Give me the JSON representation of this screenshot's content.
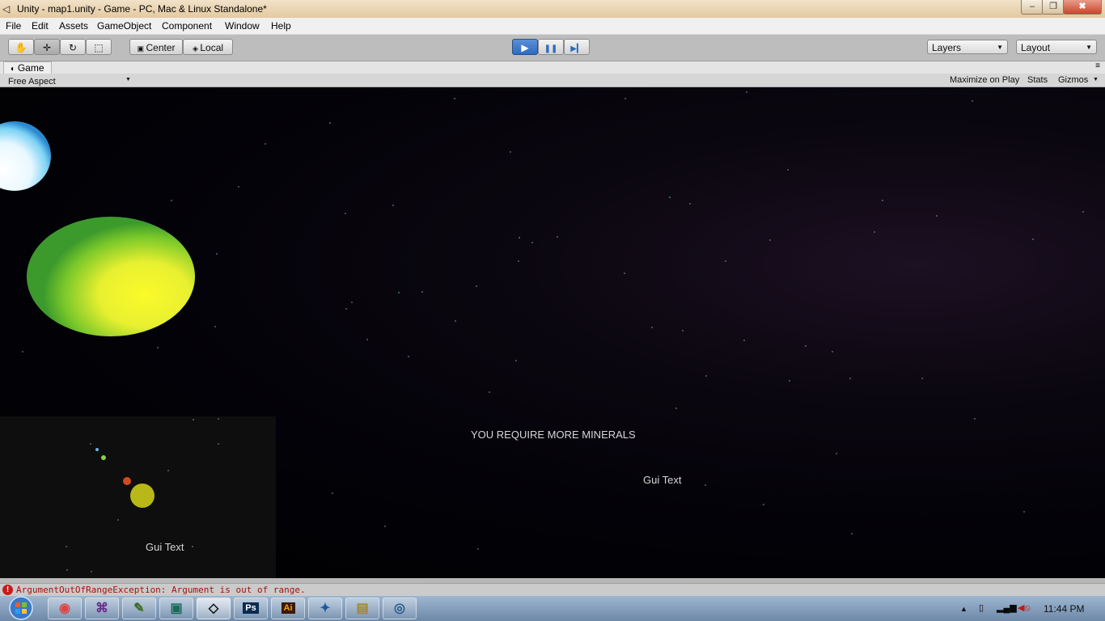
{
  "window": {
    "title": "Unity - map1.unity - Game - PC, Mac & Linux Standalone*",
    "minimize_glyph": "–",
    "maximize_glyph": "❐",
    "close_glyph": "✖"
  },
  "menu": [
    "File",
    "Edit",
    "Assets",
    "GameObject",
    "Component",
    "Window",
    "Help"
  ],
  "toolbar": {
    "tools": [
      {
        "name": "hand-tool",
        "glyph": "✋"
      },
      {
        "name": "move-tool",
        "glyph": "✛"
      },
      {
        "name": "rotate-tool",
        "glyph": "↻"
      },
      {
        "name": "scale-tool",
        "glyph": "⬚"
      }
    ],
    "pivot_label": "Center",
    "space_label": "Local",
    "play_glyph": "▶",
    "pause_glyph": "❚❚",
    "step_glyph": "▶▎",
    "layers_label": "Layers",
    "layout_label": "Layout"
  },
  "game_tab": {
    "label": "Game",
    "aspect": "Free Aspect",
    "maximize_on_play": "Maximize on Play",
    "stats": "Stats",
    "gizmos": "Gizmos"
  },
  "game_view": {
    "message": "YOU REQUIRE MORE MINERALS",
    "gui_text_main": "Gui Text",
    "gui_text_minimap": "Gui Text"
  },
  "status": {
    "error_text": "ArgumentOutOfRangeException: Argument is out of range."
  },
  "taskbar": {
    "apps": [
      {
        "name": "chrome",
        "glyph": "◉",
        "color": "#d44"
      },
      {
        "name": "visual-studio",
        "glyph": "⌘",
        "color": "#6a2a8a"
      },
      {
        "name": "notepad",
        "glyph": "✎",
        "color": "#3a6a20"
      },
      {
        "name": "terminal",
        "glyph": "▣",
        "color": "#1a6a5a"
      },
      {
        "name": "unity",
        "glyph": "◇",
        "color": "#111"
      },
      {
        "name": "photoshop",
        "glyph": "Ps",
        "color": "#2a7ac0"
      },
      {
        "name": "illustrator",
        "glyph": "Ai",
        "color": "#c04a10"
      },
      {
        "name": "network-app",
        "glyph": "✦",
        "color": "#1a5aa0"
      },
      {
        "name": "file-explorer",
        "glyph": "▤",
        "color": "#a08a20"
      },
      {
        "name": "remote-app",
        "glyph": "◎",
        "color": "#2a5a90"
      }
    ],
    "clock": "11:44 PM"
  },
  "colors": {
    "accent_play": "#2e6bc0",
    "error_red": "#c71a1a",
    "planet_green": "#3a9a2a",
    "planet_yellow": "#f4f020",
    "planet_blue": "#5ac6f0"
  }
}
